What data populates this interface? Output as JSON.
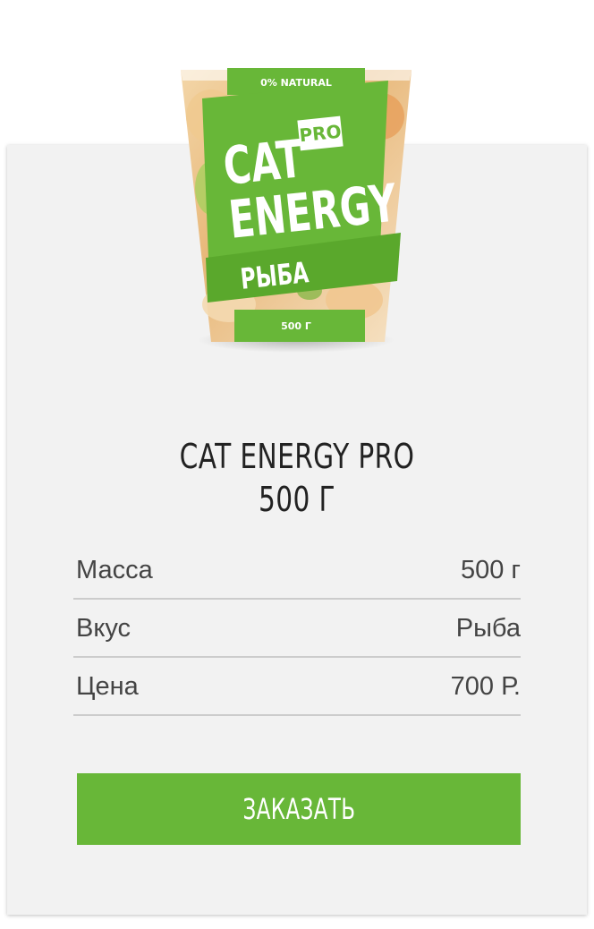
{
  "product": {
    "title_line1": "CAT ENERGY PRO",
    "title_line2": "500 Г",
    "package": {
      "natural": "0% NATURAL",
      "brand_line1": "CAT",
      "brand_line2": "ENERGY",
      "pro": "PRO",
      "flavor": "РЫБА",
      "weight": "500 Г"
    }
  },
  "specs": [
    {
      "label": "Масса",
      "value": "500 г"
    },
    {
      "label": "Вкус",
      "value": "Рыба"
    },
    {
      "label": "Цена",
      "value": "700 Р."
    }
  ],
  "order_button": {
    "label": "ЗАКАЗАТЬ"
  },
  "colors": {
    "accent": "#68b738",
    "card": "#f2f2f2"
  }
}
